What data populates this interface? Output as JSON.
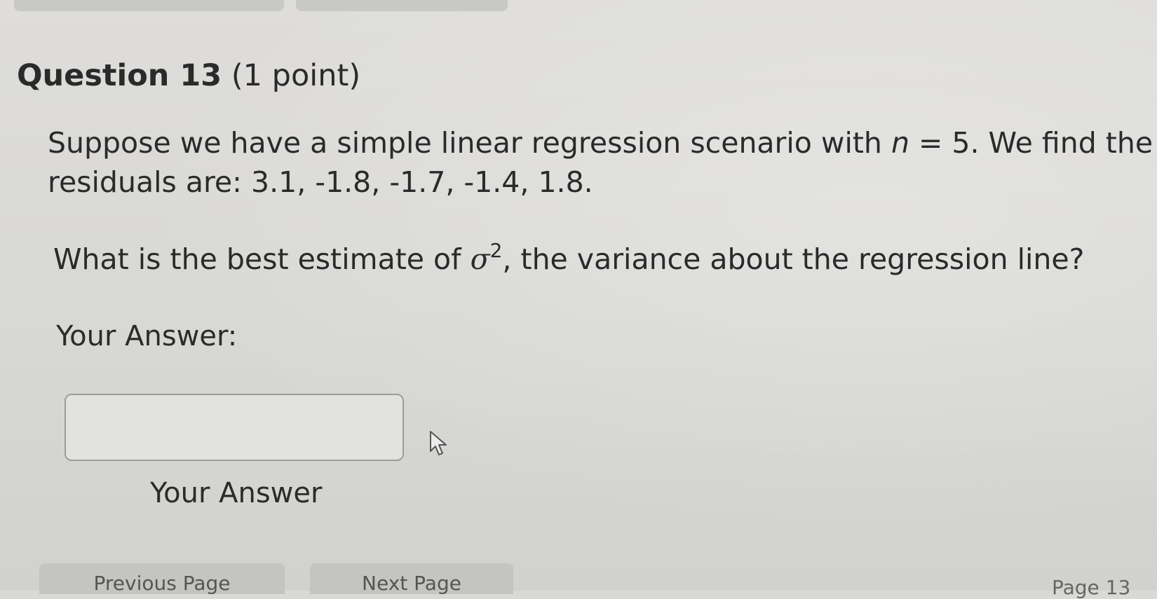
{
  "question": {
    "title_number": "Question 13",
    "title_points": "(1 point)",
    "text_line1_before": "Suppose we have a simple linear regression scenario with ",
    "text_var_n": "n",
    "text_line1_after": " = 5.  We find the",
    "text_line2": "residuals are: 3.1, -1.8, -1.7, -1.4, 1.8.",
    "prompt_before": "What is the best estimate of ",
    "prompt_symbol": "σ",
    "prompt_exponent": "2",
    "prompt_after": ", the variance about the regression line?"
  },
  "answer": {
    "label": "Your Answer:",
    "input_value": "",
    "input_placeholder": "",
    "caption": "Your Answer"
  },
  "navigation": {
    "prev_label": "Previous Page",
    "next_label": "Next Page",
    "page_indicator": "Page 13"
  },
  "colors": {
    "background": "#d9d9d6",
    "text": "#2a2a2a",
    "input_border": "#9c9c9a",
    "button": "#c4c4c1"
  }
}
